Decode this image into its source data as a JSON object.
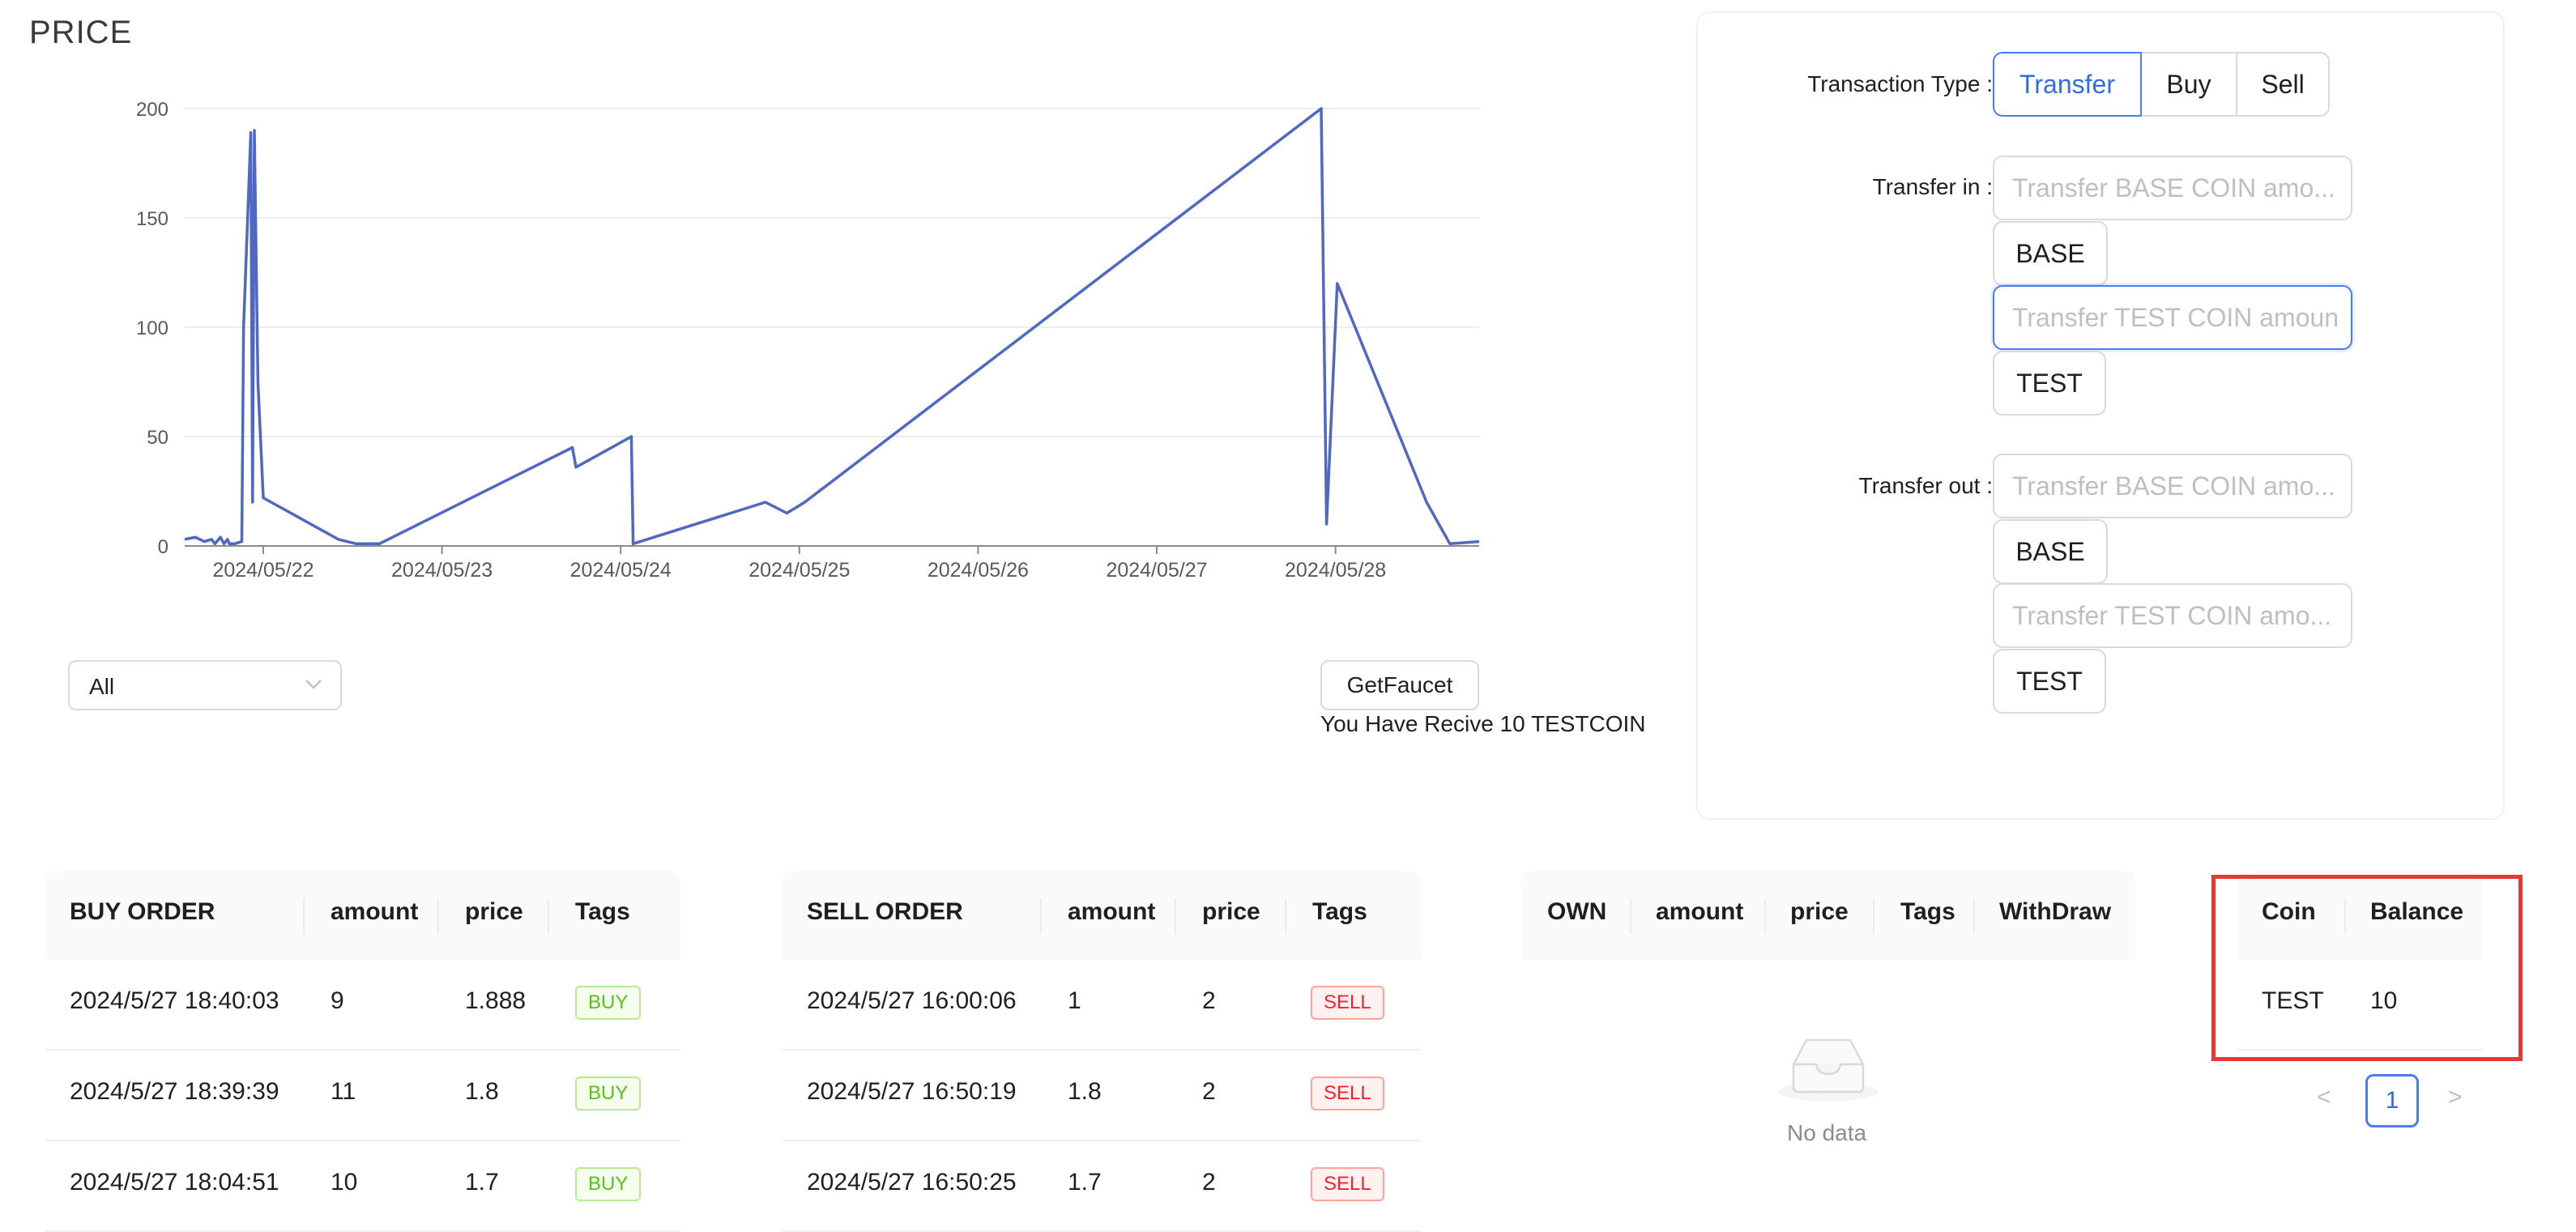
{
  "price_title": "PRICE",
  "chart_data": {
    "type": "line",
    "title": "",
    "xlabel": "",
    "ylabel": "",
    "x_ticks": [
      "2024/05/22",
      "2024/05/23",
      "2024/05/24",
      "2024/05/25",
      "2024/05/26",
      "2024/05/27",
      "2024/05/28"
    ],
    "y_ticks": [
      0,
      50,
      100,
      150,
      200
    ],
    "ylim": [
      0,
      200
    ],
    "xlim_days": [
      -0.45,
      6.75
    ],
    "grid": "horizontal",
    "color": "#4e68c4",
    "series": [
      {
        "name": "",
        "points": [
          [
            -0.44,
            3
          ],
          [
            -0.38,
            4
          ],
          [
            -0.33,
            2
          ],
          [
            -0.29,
            3
          ],
          [
            -0.27,
            1
          ],
          [
            -0.24,
            4
          ],
          [
            -0.22,
            1
          ],
          [
            -0.2,
            3
          ],
          [
            -0.19,
            1
          ],
          [
            -0.16,
            1
          ],
          [
            -0.12,
            2
          ],
          [
            -0.11,
            100
          ],
          [
            -0.07,
            189
          ],
          [
            -0.06,
            20
          ],
          [
            -0.05,
            190
          ],
          [
            -0.03,
            75
          ],
          [
            0.0,
            22
          ],
          [
            0.42,
            3
          ],
          [
            0.52,
            1
          ],
          [
            0.65,
            1
          ],
          [
            1.73,
            45
          ],
          [
            1.75,
            36
          ],
          [
            2.06,
            50
          ],
          [
            2.07,
            1
          ],
          [
            2.81,
            20
          ],
          [
            2.93,
            15
          ],
          [
            3.03,
            20
          ],
          [
            5.92,
            200
          ],
          [
            5.95,
            10
          ],
          [
            6.01,
            120
          ],
          [
            6.51,
            20
          ],
          [
            6.64,
            1
          ],
          [
            7.12,
            2
          ],
          [
            8.12,
            2
          ]
        ]
      }
    ]
  },
  "filter": {
    "selected": "All"
  },
  "faucet": {
    "button": "GetFaucet",
    "message": "You Have Recive 10 TESTCOIN"
  },
  "form": {
    "type_label": "Transaction Type",
    "types": [
      "Transfer",
      "Buy",
      "Sell"
    ],
    "active_type": "Transfer",
    "transfer_in_label": "Transfer in",
    "transfer_out_label": "Transfer out",
    "in_base_placeholder": "Transfer BASE COIN amo...",
    "in_base_button": "BASE",
    "in_test_placeholder": "Transfer TEST COIN amoun",
    "in_test_button": "TEST",
    "out_base_placeholder": "Transfer BASE COIN amo...",
    "out_base_button": "BASE",
    "out_test_placeholder": "Transfer TEST COIN amo...",
    "out_test_button": "TEST"
  },
  "buy_table": {
    "headers": [
      "BUY ORDER",
      "amount",
      "price",
      "Tags"
    ],
    "rows": [
      {
        "time": "2024/5/27 18:40:03",
        "amount": "9",
        "price": "1.888",
        "tag": "BUY"
      },
      {
        "time": "2024/5/27 18:39:39",
        "amount": "11",
        "price": "1.8",
        "tag": "BUY"
      },
      {
        "time": "2024/5/27 18:04:51",
        "amount": "10",
        "price": "1.7",
        "tag": "BUY"
      }
    ]
  },
  "sell_table": {
    "headers": [
      "SELL ORDER",
      "amount",
      "price",
      "Tags"
    ],
    "rows": [
      {
        "time": "2024/5/27 16:00:06",
        "amount": "1",
        "price": "2",
        "tag": "SELL"
      },
      {
        "time": "2024/5/27 16:50:19",
        "amount": "1.8",
        "price": "2",
        "tag": "SELL"
      },
      {
        "time": "2024/5/27 16:50:25",
        "amount": "1.7",
        "price": "2",
        "tag": "SELL"
      }
    ]
  },
  "own_table": {
    "headers": [
      "OWN",
      "amount",
      "price",
      "Tags",
      "WithDraw"
    ],
    "empty_text": "No data"
  },
  "balance_table": {
    "headers": [
      "Coin",
      "Balance"
    ],
    "rows": [
      {
        "coin": "TEST",
        "balance": "10"
      }
    ]
  },
  "pagination": {
    "current": "1",
    "prev": "<",
    "next": ">"
  }
}
